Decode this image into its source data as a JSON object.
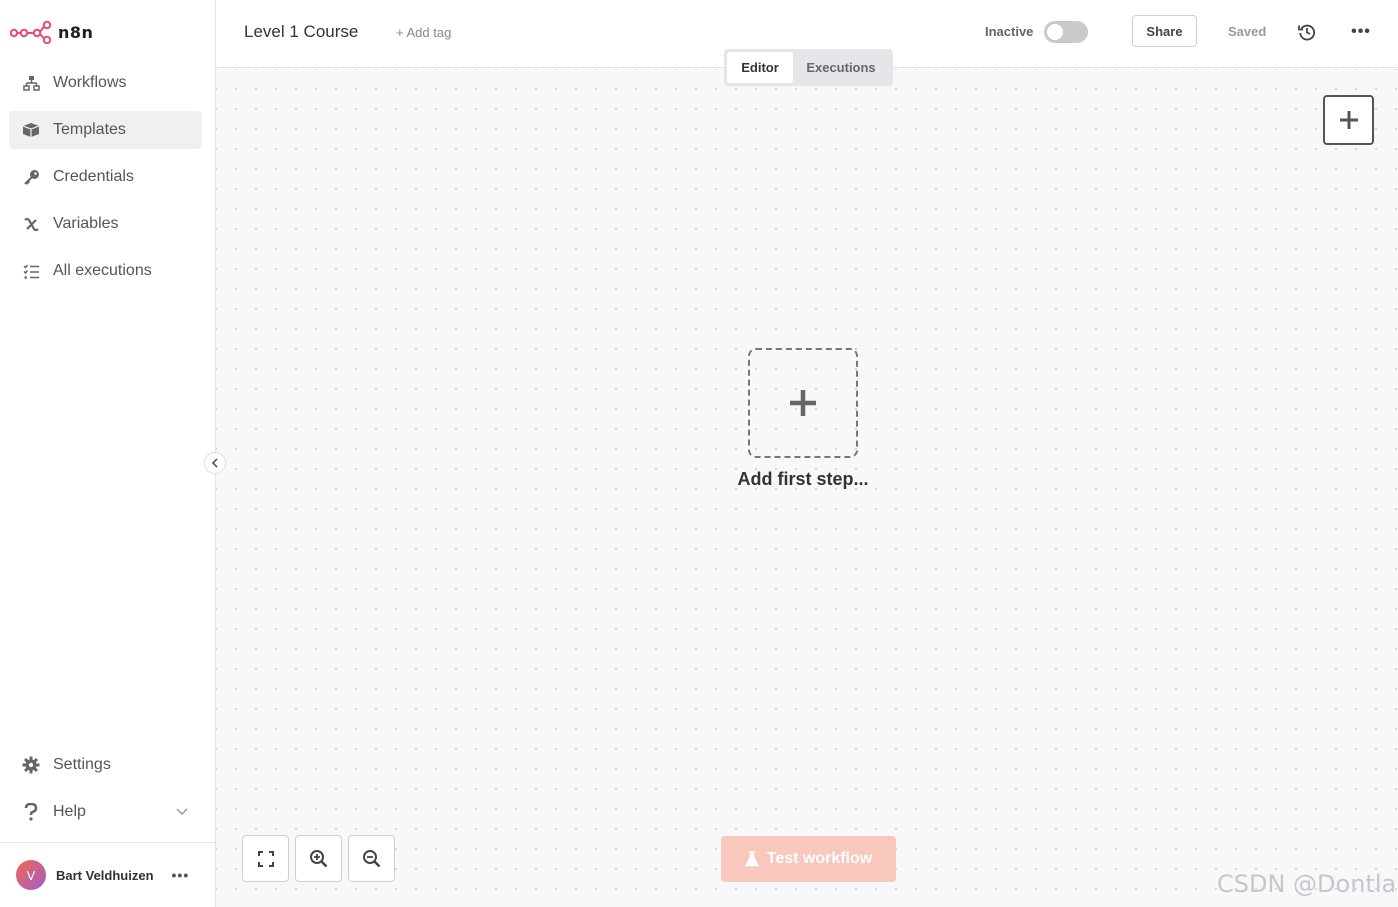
{
  "app": {
    "logo_text": "n8n",
    "brand_color": "#ea4b71"
  },
  "sidebar": {
    "items": [
      {
        "label": "Workflows",
        "icon": "workflows-icon"
      },
      {
        "label": "Templates",
        "icon": "templates-icon",
        "active": true
      },
      {
        "label": "Credentials",
        "icon": "key-icon"
      },
      {
        "label": "Variables",
        "icon": "variables-icon"
      },
      {
        "label": "All executions",
        "icon": "executions-list-icon"
      }
    ],
    "bottom_items": [
      {
        "label": "Settings",
        "icon": "gear-icon"
      },
      {
        "label": "Help",
        "icon": "question-icon"
      }
    ],
    "user": {
      "initial": "V",
      "name": "Bart Veldhuizen",
      "more": "•••"
    }
  },
  "header": {
    "workflow_name": "Level 1 Course",
    "add_tag": "+ Add tag",
    "status_label": "Inactive",
    "active": false,
    "share_label": "Share",
    "saved_label": "Saved",
    "more": "•••"
  },
  "mode_switch": {
    "tabs": [
      "Editor",
      "Executions"
    ],
    "selected": "Editor"
  },
  "canvas": {
    "add_first_step": "Add first step...",
    "test_workflow": "Test workflow"
  },
  "watermark": "CSDN @Dontla",
  "colors": {
    "canvas_bg": "#f7f8fa",
    "test_button_disabled": "#f8c8bd",
    "active_item_bg": "#f0f0f2"
  }
}
